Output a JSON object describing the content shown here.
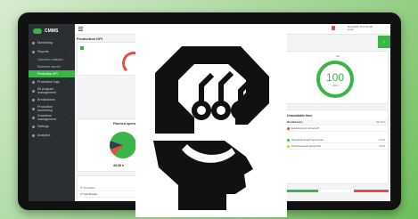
{
  "app": {
    "name": "CMMS"
  },
  "sidebar": {
    "items": [
      {
        "label": "Monitoring",
        "icon": "monitor-icon"
      },
      {
        "label": "Reports",
        "icon": "reports-icon"
      },
      {
        "label": "Production logs",
        "icon": "log-icon"
      },
      {
        "label": "MI program management",
        "icon": "program-icon"
      },
      {
        "label": "Breakdowns",
        "icon": "breakdown-icon"
      },
      {
        "label": "Production monitoring",
        "icon": "production-icon"
      },
      {
        "label": "Downtime management",
        "icon": "downtime-icon"
      },
      {
        "label": "Settings",
        "icon": "gear-icon"
      },
      {
        "label": "Analytics",
        "icon": "analytics-icon"
      }
    ],
    "report_subitems": [
      "Operation analytics",
      "Balanced reports",
      "Production KPI"
    ]
  },
  "header": {
    "page_title": "Production KPI",
    "datetime_line1": "8/27/2025, 8:57:53 AM",
    "datetime_line2": "Local"
  },
  "kpi": {
    "title": "Production 10W - 500",
    "gauge_value": "100",
    "gauge_sub": "100%",
    "gauge_label": "KA",
    "oee_title": "Planned operation"
  },
  "availability": {
    "title": "Unavailable time",
    "subtitle": "Breakdowns",
    "value": "49.74 h",
    "rows": [
      {
        "label": "Equipment is turned off",
        "color": "#e74c3c"
      },
      {
        "label": "Operational and setup time",
        "color": "#3bb54a",
        "pct": "0.0%"
      },
      {
        "label": "Technical and setup time",
        "color": "#f1c40f",
        "pct": "0.0%"
      }
    ]
  },
  "bottom": {
    "summary": "49.58 h",
    "list": [
      "IT 7/4 Cham",
      "CT-HA Breaks"
    ]
  },
  "colors": {
    "brand": "#3bb54a",
    "sidebar": "#2b2f33",
    "danger": "#e74c3c"
  }
}
